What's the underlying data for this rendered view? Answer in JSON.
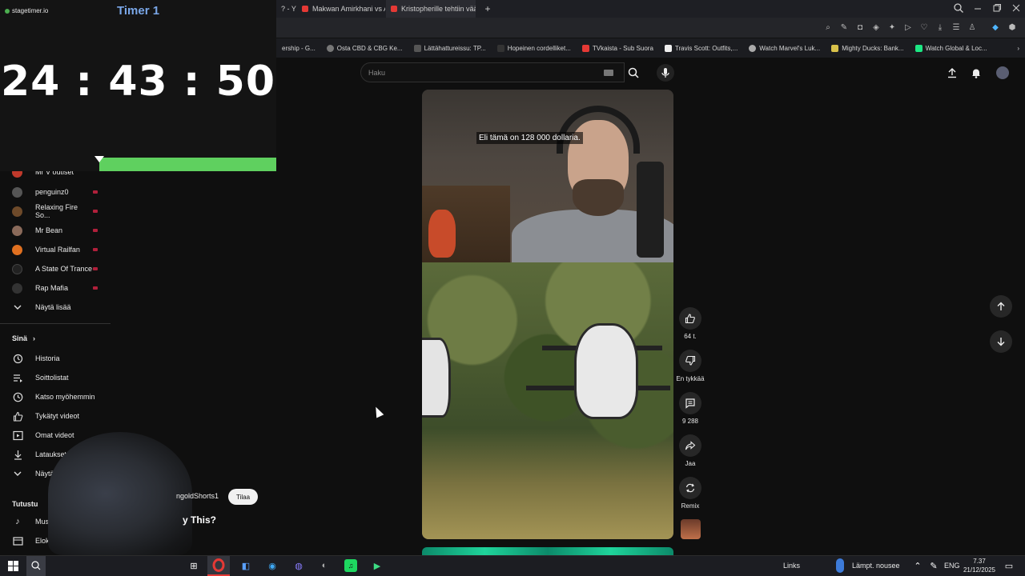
{
  "browser": {
    "tabs": [
      {
        "title": "? - Y",
        "icon": "youtube-icon",
        "active": false
      },
      {
        "title": "Makwan Amirkhani vs Ab",
        "icon": "youtube-icon",
        "active": false
      },
      {
        "title": "Kristopherille tehtiin väärin",
        "icon": "youtube-icon",
        "active": true
      }
    ],
    "new_tab": "+",
    "bookmarks": [
      {
        "label": "ership - G...",
        "icon": "bookmark-icon"
      },
      {
        "label": "Osta CBD & CBG Ke...",
        "icon": "globe-icon"
      },
      {
        "label": "Lättähattureissu: TP...",
        "icon": "bookmark-icon"
      },
      {
        "label": "Hopeinen cordelliket...",
        "icon": "kt-icon"
      },
      {
        "label": "TVkaista - Sub Suora",
        "icon": "tv-icon"
      },
      {
        "label": "Travis Scott: Outfits,...",
        "icon": "w-icon"
      },
      {
        "label": "Watch Marvel's Luk...",
        "icon": "cog-icon"
      },
      {
        "label": "Mighty Ducks: Bank...",
        "icon": "bolt-icon"
      },
      {
        "label": "Watch Global & Loc...",
        "icon": "hulu-icon"
      }
    ]
  },
  "timer": {
    "logo": "stagetimer.io",
    "title": "Timer 1",
    "time": "24 : 43 : 50",
    "progress_remaining": 0.64,
    "bar_color": "#5fd05f"
  },
  "sidebar": {
    "subscriptions": [
      {
        "label": "Mr V outlset",
        "avatar_color": "#c0392b",
        "live": false
      },
      {
        "label": "penguinz0",
        "avatar_color": "#555555",
        "live": true
      },
      {
        "label": "Relaxing Fire So...",
        "avatar_color": "#6e4a2a",
        "live": true
      },
      {
        "label": "Mr Bean",
        "avatar_color": "#8a6a5a",
        "live": true
      },
      {
        "label": "Virtual Railfan",
        "avatar_color": "#e07020",
        "live": true
      },
      {
        "label": "A State Of Trance",
        "avatar_color": "#222222",
        "live": true
      },
      {
        "label": "Rap Mafia",
        "avatar_color": "#333333",
        "live": true
      }
    ],
    "show_more_1": "Näytä lisää",
    "you_header": "Sinä",
    "you_items": [
      {
        "label": "Historia",
        "icon": "history-icon"
      },
      {
        "label": "Soittolistat",
        "icon": "playlist-icon"
      },
      {
        "label": "Katso myöhemmin",
        "icon": "watch-later-icon"
      },
      {
        "label": "Tykätyt videot",
        "icon": "thumbs-up-icon"
      },
      {
        "label": "Omat videot",
        "icon": "my-videos-icon"
      },
      {
        "label": "Lataukset",
        "icon": "download-icon"
      }
    ],
    "show_more_2": "Näytä lisää",
    "explore_header": "Tutustu",
    "explore_items": [
      {
        "label": "Musiikki",
        "icon": "music-icon"
      },
      {
        "label": "Elokuvat",
        "icon": "film-icon"
      }
    ]
  },
  "search": {
    "placeholder": "Haku"
  },
  "short": {
    "caption": "Eli tämä on 128 000 dollaria.",
    "channel": "ngoldShorts1",
    "subscribe_label": "Tilaa",
    "title": "y This?"
  },
  "actions": {
    "like_count": "64 t.",
    "dislike_label": "En tykkää",
    "comment_count": "9 288",
    "share_label": "Jaa",
    "remix_label": "Remix"
  },
  "taskbar": {
    "links_label": "Links",
    "weather_text": "Lämpt. nousee",
    "language": "ENG",
    "time": "7.37",
    "date": "21/12/2025"
  }
}
